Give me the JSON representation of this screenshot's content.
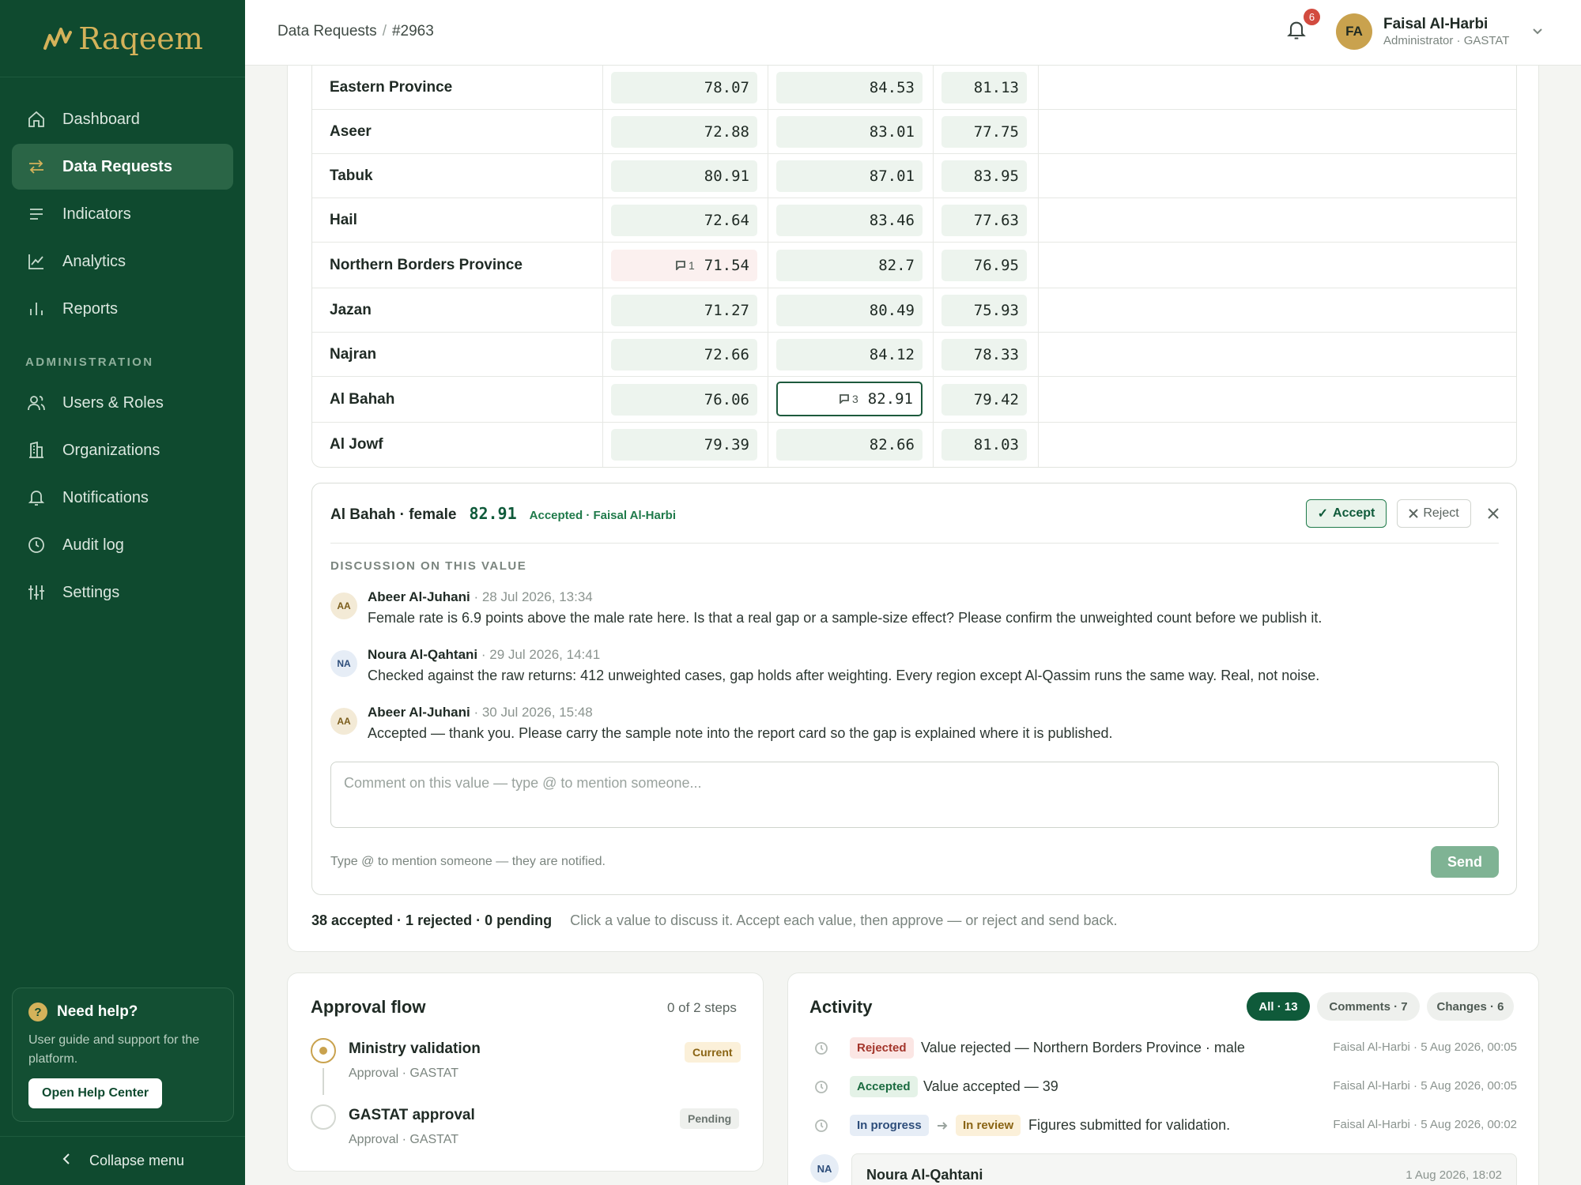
{
  "brand": {
    "name": "Raqeem",
    "color": "#0f4a2f",
    "accent": "#d4b25a"
  },
  "sidebar": {
    "items": [
      {
        "label": "Dashboard",
        "icon": "home-icon"
      },
      {
        "label": "Data Requests",
        "icon": "swap-icon",
        "active": true
      },
      {
        "label": "Indicators",
        "icon": "list-icon"
      },
      {
        "label": "Analytics",
        "icon": "line-chart-icon"
      },
      {
        "label": "Reports",
        "icon": "bar-chart-icon"
      }
    ],
    "admin_label": "ADMINISTRATION",
    "admin_items": [
      {
        "label": "Users & Roles",
        "icon": "users-icon"
      },
      {
        "label": "Organizations",
        "icon": "building-icon"
      },
      {
        "label": "Notifications",
        "icon": "bell-icon"
      },
      {
        "label": "Audit log",
        "icon": "clock-icon"
      },
      {
        "label": "Settings",
        "icon": "sliders-icon"
      }
    ],
    "help": {
      "title": "Need help?",
      "text": "User guide and support for the platform.",
      "button": "Open Help Center"
    },
    "collapse_label": "Collapse menu"
  },
  "header": {
    "breadcrumb": [
      "Data Requests",
      "#2963"
    ],
    "notifications_count": "6",
    "user": {
      "initials": "FA",
      "name": "Faisal Al-Harbi",
      "role": "Administrator · GASTAT"
    }
  },
  "table": {
    "rows": [
      {
        "region": "Eastern Province",
        "v1": "78.07",
        "v2": "84.53",
        "v3": "81.13"
      },
      {
        "region": "Aseer",
        "v1": "72.88",
        "v2": "83.01",
        "v3": "77.75"
      },
      {
        "region": "Tabuk",
        "v1": "80.91",
        "v2": "87.01",
        "v3": "83.95"
      },
      {
        "region": "Hail",
        "v1": "72.64",
        "v2": "83.46",
        "v3": "77.63"
      },
      {
        "region": "Northern Borders Province",
        "v1": "71.54",
        "v1_comments": "1",
        "v2": "82.7",
        "v3": "76.95"
      },
      {
        "region": "Jazan",
        "v1": "71.27",
        "v2": "80.49",
        "v3": "75.93"
      },
      {
        "region": "Najran",
        "v1": "72.66",
        "v2": "84.12",
        "v3": "78.33"
      },
      {
        "region": "Al Bahah",
        "v1": "76.06",
        "v2": "82.91",
        "v2_comments": "3",
        "v3": "79.42"
      },
      {
        "region": "Al Jowf",
        "v1": "79.39",
        "v2": "82.66",
        "v3": "81.03"
      }
    ]
  },
  "discussion": {
    "title": "Al Bahah · female",
    "value": "82.91",
    "status": "Accepted · Faisal Al-Harbi",
    "accept_label": "Accept",
    "reject_label": "Reject",
    "section_label": "DISCUSSION ON THIS VALUE",
    "comments": [
      {
        "initials": "AA",
        "author": "Abeer Al-Juhani",
        "time": "· 28 Jul 2026, 13:34",
        "body": "Female rate is 6.9 points above the male rate here. Is that a real gap or a sample-size effect? Please confirm the unweighted count before we publish it."
      },
      {
        "initials": "NA",
        "author": "Noura Al-Qahtani",
        "time": "· 29 Jul 2026, 14:41",
        "body": "Checked against the raw returns: 412 unweighted cases, gap holds after weighting. Every region except Al-Qassim runs the same way. Real, not noise."
      },
      {
        "initials": "AA",
        "author": "Abeer Al-Juhani",
        "time": "· 30 Jul 2026, 15:48",
        "body": "Accepted — thank you. Please carry the sample note into the report card so the gap is explained where it is published."
      }
    ],
    "input_placeholder": "Comment on this value — type @ to mention someone...",
    "hint": "Type @ to mention someone — they are notified.",
    "send_label": "Send"
  },
  "summary": {
    "counts": "38 accepted · 1 rejected · 0 pending",
    "note": "Click a value to discuss it. Accept each value, then approve — or reject and send back."
  },
  "approval": {
    "title": "Approval flow",
    "steps_label": "0 of 2 steps",
    "steps": [
      {
        "name": "Ministry validation",
        "sub": "Approval · GASTAT",
        "badge": "Current"
      },
      {
        "name": "GASTAT approval",
        "sub": "Approval · GASTAT",
        "badge": "Pending"
      }
    ]
  },
  "activity": {
    "title": "Activity",
    "filters": [
      "All · 13",
      "Comments · 7",
      "Changes · 6"
    ],
    "rows": [
      {
        "tag": "Rejected",
        "text": "Value rejected — Northern Borders Province · male",
        "meta": "Faisal Al-Harbi · 5 Aug 2026, 00:05"
      },
      {
        "tag": "Accepted",
        "text": "Value accepted — 39",
        "meta": "Faisal Al-Harbi · 5 Aug 2026, 00:05"
      },
      {
        "tag": "In progress",
        "tag2": "In review",
        "text": "Figures submitted for validation.",
        "meta": "Faisal Al-Harbi · 5 Aug 2026, 00:02"
      }
    ],
    "comment": {
      "initials": "NA",
      "author": "Noura Al-Qahtani",
      "time": "1 Aug 2026, 18:02"
    }
  }
}
